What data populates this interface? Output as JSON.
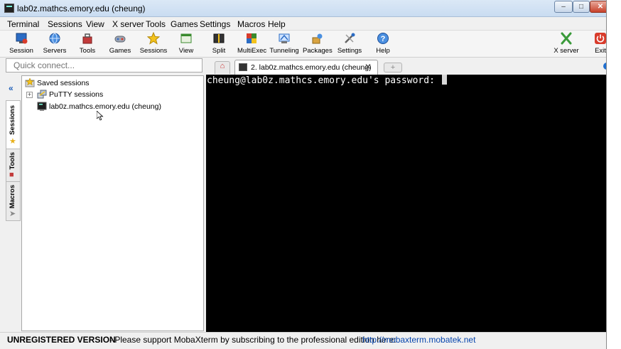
{
  "window": {
    "title": "lab0z.mathcs.emory.edu (cheung)",
    "controls": {
      "minimize": "–",
      "maximize": "□",
      "close": "✕"
    }
  },
  "menu": [
    "Terminal",
    "Sessions",
    "View",
    "X server",
    "Tools",
    "Games",
    "Settings",
    "Macros",
    "Help"
  ],
  "toolbar": {
    "session": "Session",
    "servers": "Servers",
    "tools": "Tools",
    "games": "Games",
    "sessions": "Sessions",
    "view": "View",
    "split": "Split",
    "multiexec": "MultiExec",
    "tunneling": "Tunneling",
    "packages": "Packages",
    "settings": "Settings",
    "help": "Help",
    "xserver": "X server",
    "exit": "Exit"
  },
  "icons": {
    "session": "monitor-icon",
    "servers": "globe-icon",
    "tools": "toolbox-icon",
    "games": "gamepad-icon",
    "sessions": "star-icon",
    "view": "window-icon",
    "split": "split-icon",
    "multiexec": "multiexec-icon",
    "tunneling": "tunnel-icon",
    "packages": "packages-icon",
    "settings": "settings-icon",
    "help": "help-icon",
    "xserver": "x-server-icon",
    "exit": "power-icon"
  },
  "quick_connect": {
    "placeholder": "Quick connect..."
  },
  "side_tabs": {
    "collapse": "«",
    "sessions": "Sessions",
    "tools": "Tools",
    "macros": "Macros"
  },
  "session_tree": {
    "root": "Saved sessions",
    "expander": "+",
    "items": [
      "PuTTY sessions",
      "lab0z.mathcs.emory.edu (cheung)"
    ]
  },
  "tabs": {
    "active_label": "2. lab0z.mathcs.emory.edu (cheung)",
    "close": "✕",
    "new_tab": "+"
  },
  "terminal": {
    "prompt": "cheung@lab0z.mathcs.emory.edu's password: "
  },
  "status": {
    "unregistered": "UNREGISTERED VERSION",
    "message": "-  Please support MobaXterm by subscribing to the professional edition here:",
    "link": "http://mobaxterm.mobatek.net"
  },
  "colors": {
    "titlebar": "#c9dcf1",
    "terminal_bg": "#000000",
    "terminal_fg": "#ffffff",
    "link": "#0645ad",
    "close_button": "#c7402a"
  }
}
